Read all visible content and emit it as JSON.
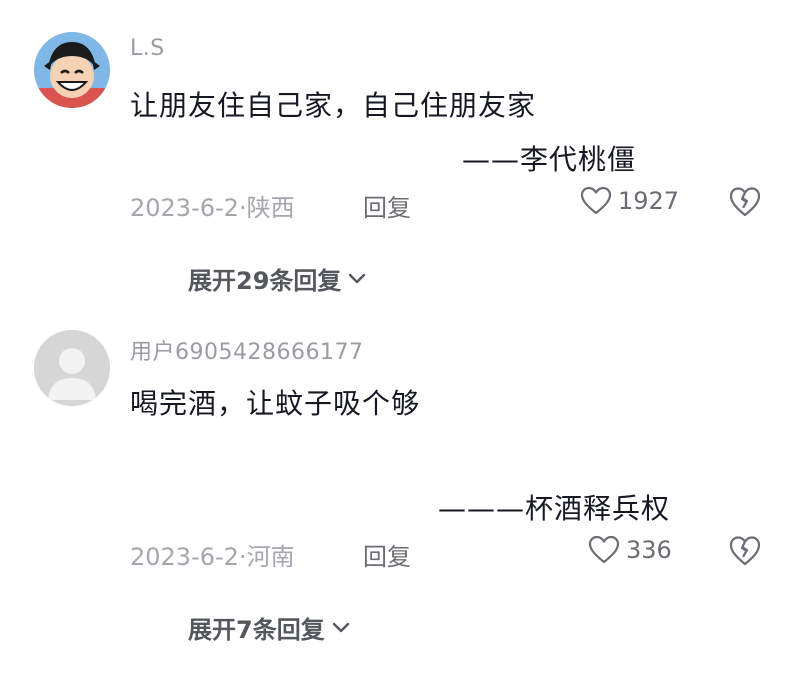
{
  "comments": [
    {
      "username": "L.S",
      "text": "让朋友住自己家，自己住朋友家",
      "signature": "——李代桃僵",
      "date": "2023-6-2·",
      "location": "陕西",
      "reply_label": "回复",
      "likes": "1927",
      "expand_label": "展开29条回复",
      "avatar": "cartoon-avatar"
    },
    {
      "username": "用户6905428666177",
      "text": "喝完酒，让蚊子吸个够",
      "signature": "———杯酒释兵权",
      "date": "2023-6-2·",
      "location": "河南",
      "reply_label": "回复",
      "likes": "336",
      "expand_label": "展开7条回复",
      "avatar": "default-avatar"
    }
  ],
  "colors": {
    "text": "#161823",
    "muted": "#a4a6ad",
    "secondary": "#6b6d75"
  }
}
